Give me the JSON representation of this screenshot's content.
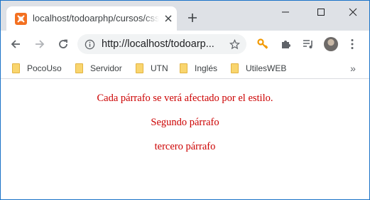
{
  "colors": {
    "paragraph_text": "#cc0000",
    "tabstrip_bg": "#dee1e6",
    "favicon": "#f37021"
  },
  "tab": {
    "title": "localhost/todoarphp/cursos/css/",
    "favicon_icon": "xampp-icon",
    "close_icon": "close-icon"
  },
  "new_tab_icon": "plus-icon",
  "window_controls": {
    "minimize_icon": "minimize-icon",
    "maximize_icon": "maximize-icon",
    "close_icon": "close-icon"
  },
  "toolbar": {
    "back_icon": "back-arrow-icon",
    "forward_icon": "forward-arrow-icon",
    "reload_icon": "reload-icon",
    "url": "http://localhost/todoarp...",
    "info_icon": "info-icon",
    "star_icon": "star-icon",
    "extensions": [
      "key-icon",
      "puzzle-icon",
      "media-control-icon"
    ],
    "avatar_icon": "profile-avatar-icon",
    "menu_icon": "kebab-menu-icon"
  },
  "bookmarks": {
    "items": [
      {
        "label": "PocoUso",
        "icon": "folder-icon"
      },
      {
        "label": "Servidor",
        "icon": "folder-icon"
      },
      {
        "label": "UTN",
        "icon": "folder-icon"
      },
      {
        "label": "Inglés",
        "icon": "folder-icon"
      },
      {
        "label": "UtilesWEB",
        "icon": "folder-icon"
      }
    ],
    "more_label": "»"
  },
  "page": {
    "paragraphs": [
      "Cada párrafo se verá afectado por el estilo.",
      "Segundo párrafo",
      "tercero párrafo"
    ]
  }
}
